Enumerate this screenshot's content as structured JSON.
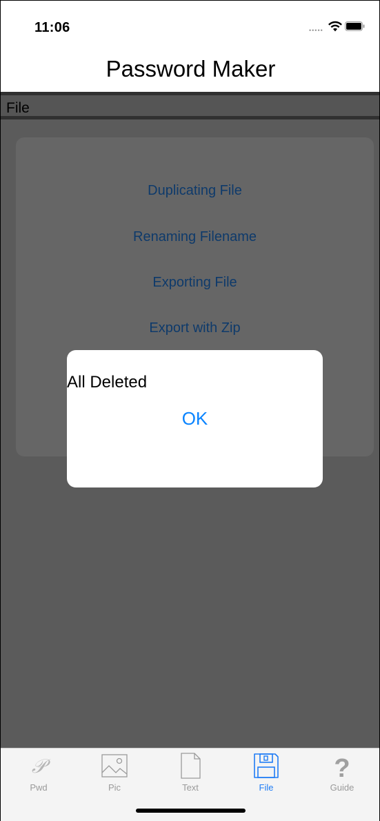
{
  "status_bar": {
    "time": "11:06"
  },
  "nav_bar": {
    "title": "Password Maker"
  },
  "section": {
    "label": "File"
  },
  "menu": {
    "items": [
      {
        "label": "Duplicating File"
      },
      {
        "label": "Renaming Filename"
      },
      {
        "label": "Exporting File"
      },
      {
        "label": "Export with Zip"
      }
    ]
  },
  "alert": {
    "message": "All Deleted",
    "ok_label": "OK"
  },
  "tab_bar": {
    "tabs": [
      {
        "label": "Pwd",
        "icon": "script-p-icon",
        "active": false
      },
      {
        "label": "Pic",
        "icon": "picture-icon",
        "active": false
      },
      {
        "label": "Text",
        "icon": "document-icon",
        "active": false
      },
      {
        "label": "File",
        "icon": "floppy-disk-icon",
        "active": true
      },
      {
        "label": "Guide",
        "icon": "question-mark-icon",
        "active": false
      }
    ]
  },
  "colors": {
    "accent": "#0a84ff",
    "active_tab": "#1f7cf5",
    "inactive_tab": "#9a9a9a",
    "dim_overlay": "#5b5b5b",
    "dimmed_link": "#0e3a6b"
  }
}
